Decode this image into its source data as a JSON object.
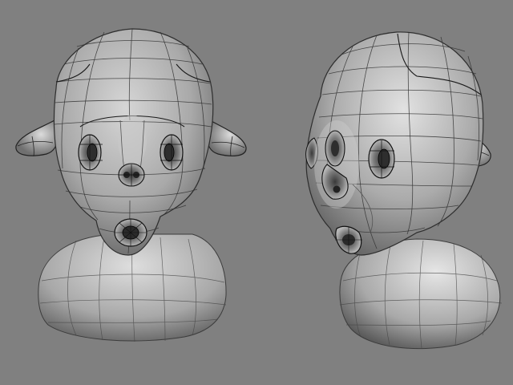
{
  "scene": {
    "views": [
      "front-view",
      "three-quarter-view"
    ]
  }
}
